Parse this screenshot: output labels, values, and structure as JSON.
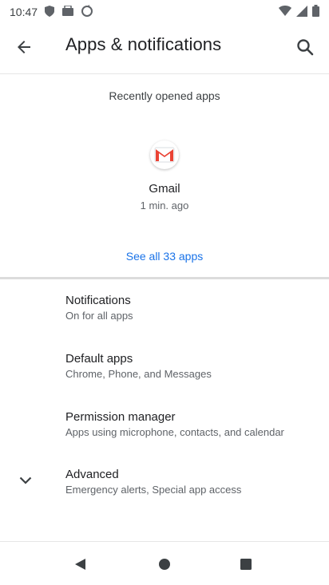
{
  "status_bar": {
    "time": "10:47"
  },
  "app_bar": {
    "title": "Apps & notifications"
  },
  "recent": {
    "header": "Recently opened apps",
    "apps": [
      {
        "name": "Gmail",
        "time": "1 min. ago",
        "icon": "gmail-icon"
      }
    ],
    "see_all": "See all 33 apps"
  },
  "settings": [
    {
      "title": "Notifications",
      "subtitle": "On for all apps"
    },
    {
      "title": "Default apps",
      "subtitle": "Chrome, Phone, and Messages"
    },
    {
      "title": "Permission manager",
      "subtitle": "Apps using microphone, contacts, and calendar"
    },
    {
      "title": "Advanced",
      "subtitle": "Emergency alerts, Special app access"
    }
  ],
  "colors": {
    "accent": "#1a73e8",
    "gmail_red": "#ea4335"
  }
}
